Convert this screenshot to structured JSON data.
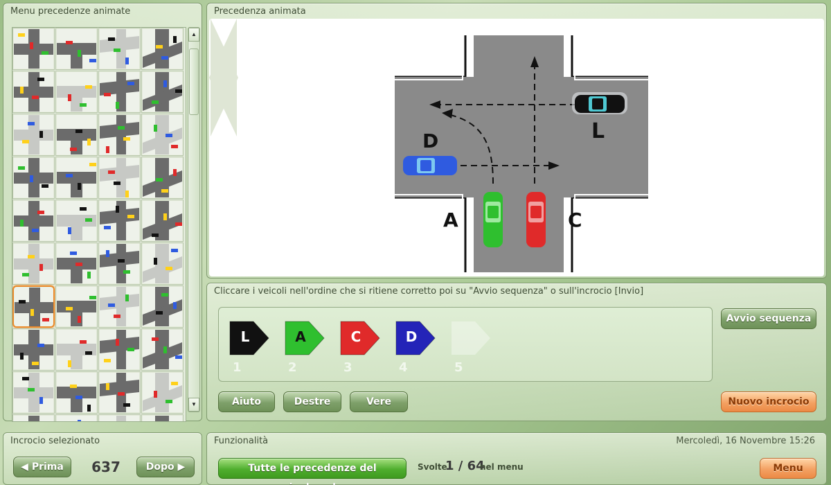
{
  "menu": {
    "title": "Menu precedenze animate",
    "selected_index": 24,
    "thumb_count": 40,
    "scroll_up_icon": "triangle-up-icon",
    "scroll_down_icon": "triangle-down-icon"
  },
  "animation": {
    "title": "Precedenza animata",
    "vehicles": [
      {
        "letter": "L",
        "color": "#111111"
      },
      {
        "letter": "D",
        "color": "#2f5be0"
      },
      {
        "letter": "A",
        "color": "#2fbf2f"
      },
      {
        "letter": "C",
        "color": "#e02a2a"
      }
    ],
    "prev_icon": "chevron-left-icon",
    "next_icon": "chevron-right-icon"
  },
  "sequence": {
    "instruction": "Cliccare i veicoli nell'ordine che si ritiene corretto poi su \"Avvio sequenza\" o sull'incrocio [Invio]",
    "slots": [
      {
        "num": "1",
        "letter": "L",
        "color": "#111111",
        "text_color": "#ffffff"
      },
      {
        "num": "2",
        "letter": "A",
        "color": "#2fbf2f",
        "text_color": "#111111"
      },
      {
        "num": "3",
        "letter": "C",
        "color": "#e02a2a",
        "text_color": "#ffffff"
      },
      {
        "num": "4",
        "letter": "D",
        "color": "#2424b8",
        "text_color": "#ffffff"
      },
      {
        "num": "5",
        "letter": "",
        "color": "",
        "text_color": ""
      }
    ],
    "start_label": "Avvio sequenza",
    "help_label": "Aiuto",
    "right_label": "Destre",
    "true_label": "Vere",
    "new_label": "Nuovo incrocio"
  },
  "selection": {
    "title": "Incrocio selezionato",
    "prev_label": "Prima",
    "next_label": "Dopo",
    "number": "637"
  },
  "functions": {
    "title": "Funzionalità",
    "datetime": "Mercoledì, 16 Novembre 15:26",
    "all_label": "Tutte le precedenze del pieghevole",
    "done_prefix": "Svolte",
    "done_count": "1 / 64",
    "done_suffix": "nel menu",
    "menu_label": "Menu"
  }
}
